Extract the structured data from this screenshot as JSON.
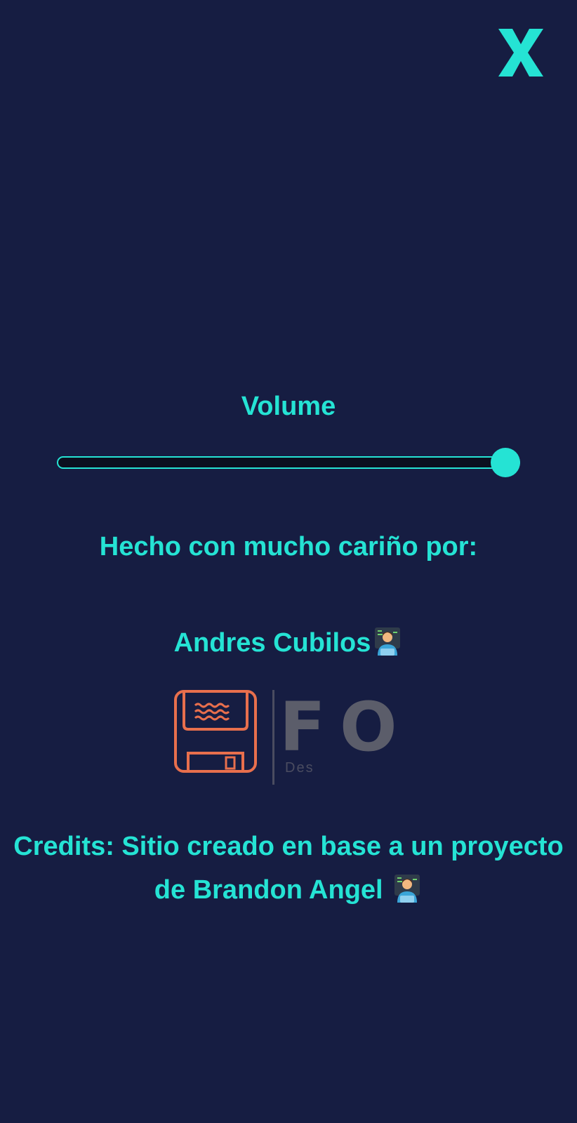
{
  "close": {
    "label": "X",
    "icon": "close-icon"
  },
  "volume": {
    "label": "Volume",
    "value": 1.0
  },
  "made_by": {
    "text": "Hecho con mucho cariño por:"
  },
  "author": {
    "name": "Andres Cubilos",
    "emoji": "technologist-emoji"
  },
  "logo": {
    "icon": "floppy-disk-icon",
    "letter1": "F",
    "letter2": "O",
    "subtitle": "Des"
  },
  "credits": {
    "line1": "Credits: Sitio creado en base a un proyecto",
    "line2": "de Brandon Angel",
    "emoji": "technologist-emoji"
  },
  "colors": {
    "background": "#161d42",
    "accent": "#25e3d4",
    "logo_orange": "#e86f4d",
    "logo_gray": "#5b5d6a"
  }
}
